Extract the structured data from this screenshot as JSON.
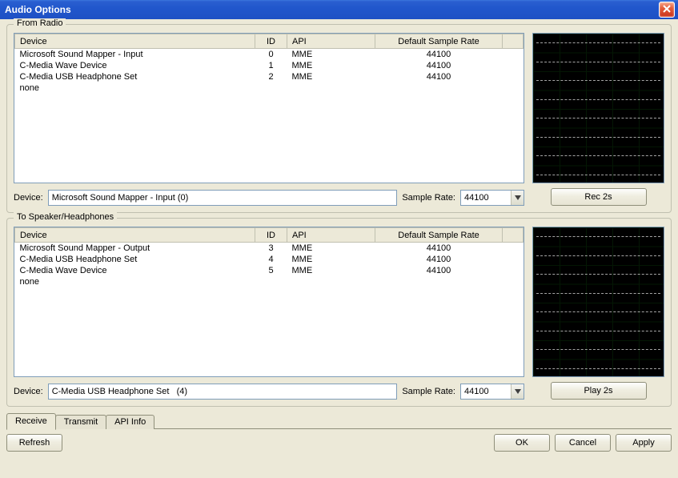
{
  "window": {
    "title": "Audio Options"
  },
  "from_radio": {
    "legend": "From Radio",
    "columns": {
      "device": "Device",
      "id": "ID",
      "api": "API",
      "rate": "Default Sample Rate"
    },
    "rows": [
      {
        "device": "Microsoft Sound Mapper - Input",
        "id": "0",
        "api": "MME",
        "rate": "44100"
      },
      {
        "device": "C-Media Wave Device",
        "id": "1",
        "api": "MME",
        "rate": "44100"
      },
      {
        "device": "C-Media USB Headphone Set",
        "id": "2",
        "api": "MME",
        "rate": "44100"
      },
      {
        "device": "none",
        "id": "",
        "api": "",
        "rate": ""
      }
    ],
    "device_label": "Device:",
    "device_value": "Microsoft Sound Mapper - Input (0)",
    "rate_label": "Sample Rate:",
    "rate_value": "44100",
    "button": "Rec 2s"
  },
  "to_speaker": {
    "legend": "To Speaker/Headphones",
    "columns": {
      "device": "Device",
      "id": "ID",
      "api": "API",
      "rate": "Default Sample Rate"
    },
    "rows": [
      {
        "device": "Microsoft Sound Mapper - Output",
        "id": "3",
        "api": "MME",
        "rate": "44100"
      },
      {
        "device": "C-Media USB Headphone Set",
        "id": "4",
        "api": "MME",
        "rate": "44100"
      },
      {
        "device": "C-Media Wave Device",
        "id": "5",
        "api": "MME",
        "rate": "44100"
      },
      {
        "device": "none",
        "id": "",
        "api": "",
        "rate": ""
      }
    ],
    "device_label": "Device:",
    "device_value": "C-Media USB Headphone Set   (4)",
    "rate_label": "Sample Rate:",
    "rate_value": "44100",
    "button": "Play 2s"
  },
  "tabs": {
    "receive": "Receive",
    "transmit": "Transmit",
    "api": "API Info"
  },
  "footer": {
    "refresh": "Refresh",
    "ok": "OK",
    "cancel": "Cancel",
    "apply": "Apply"
  }
}
